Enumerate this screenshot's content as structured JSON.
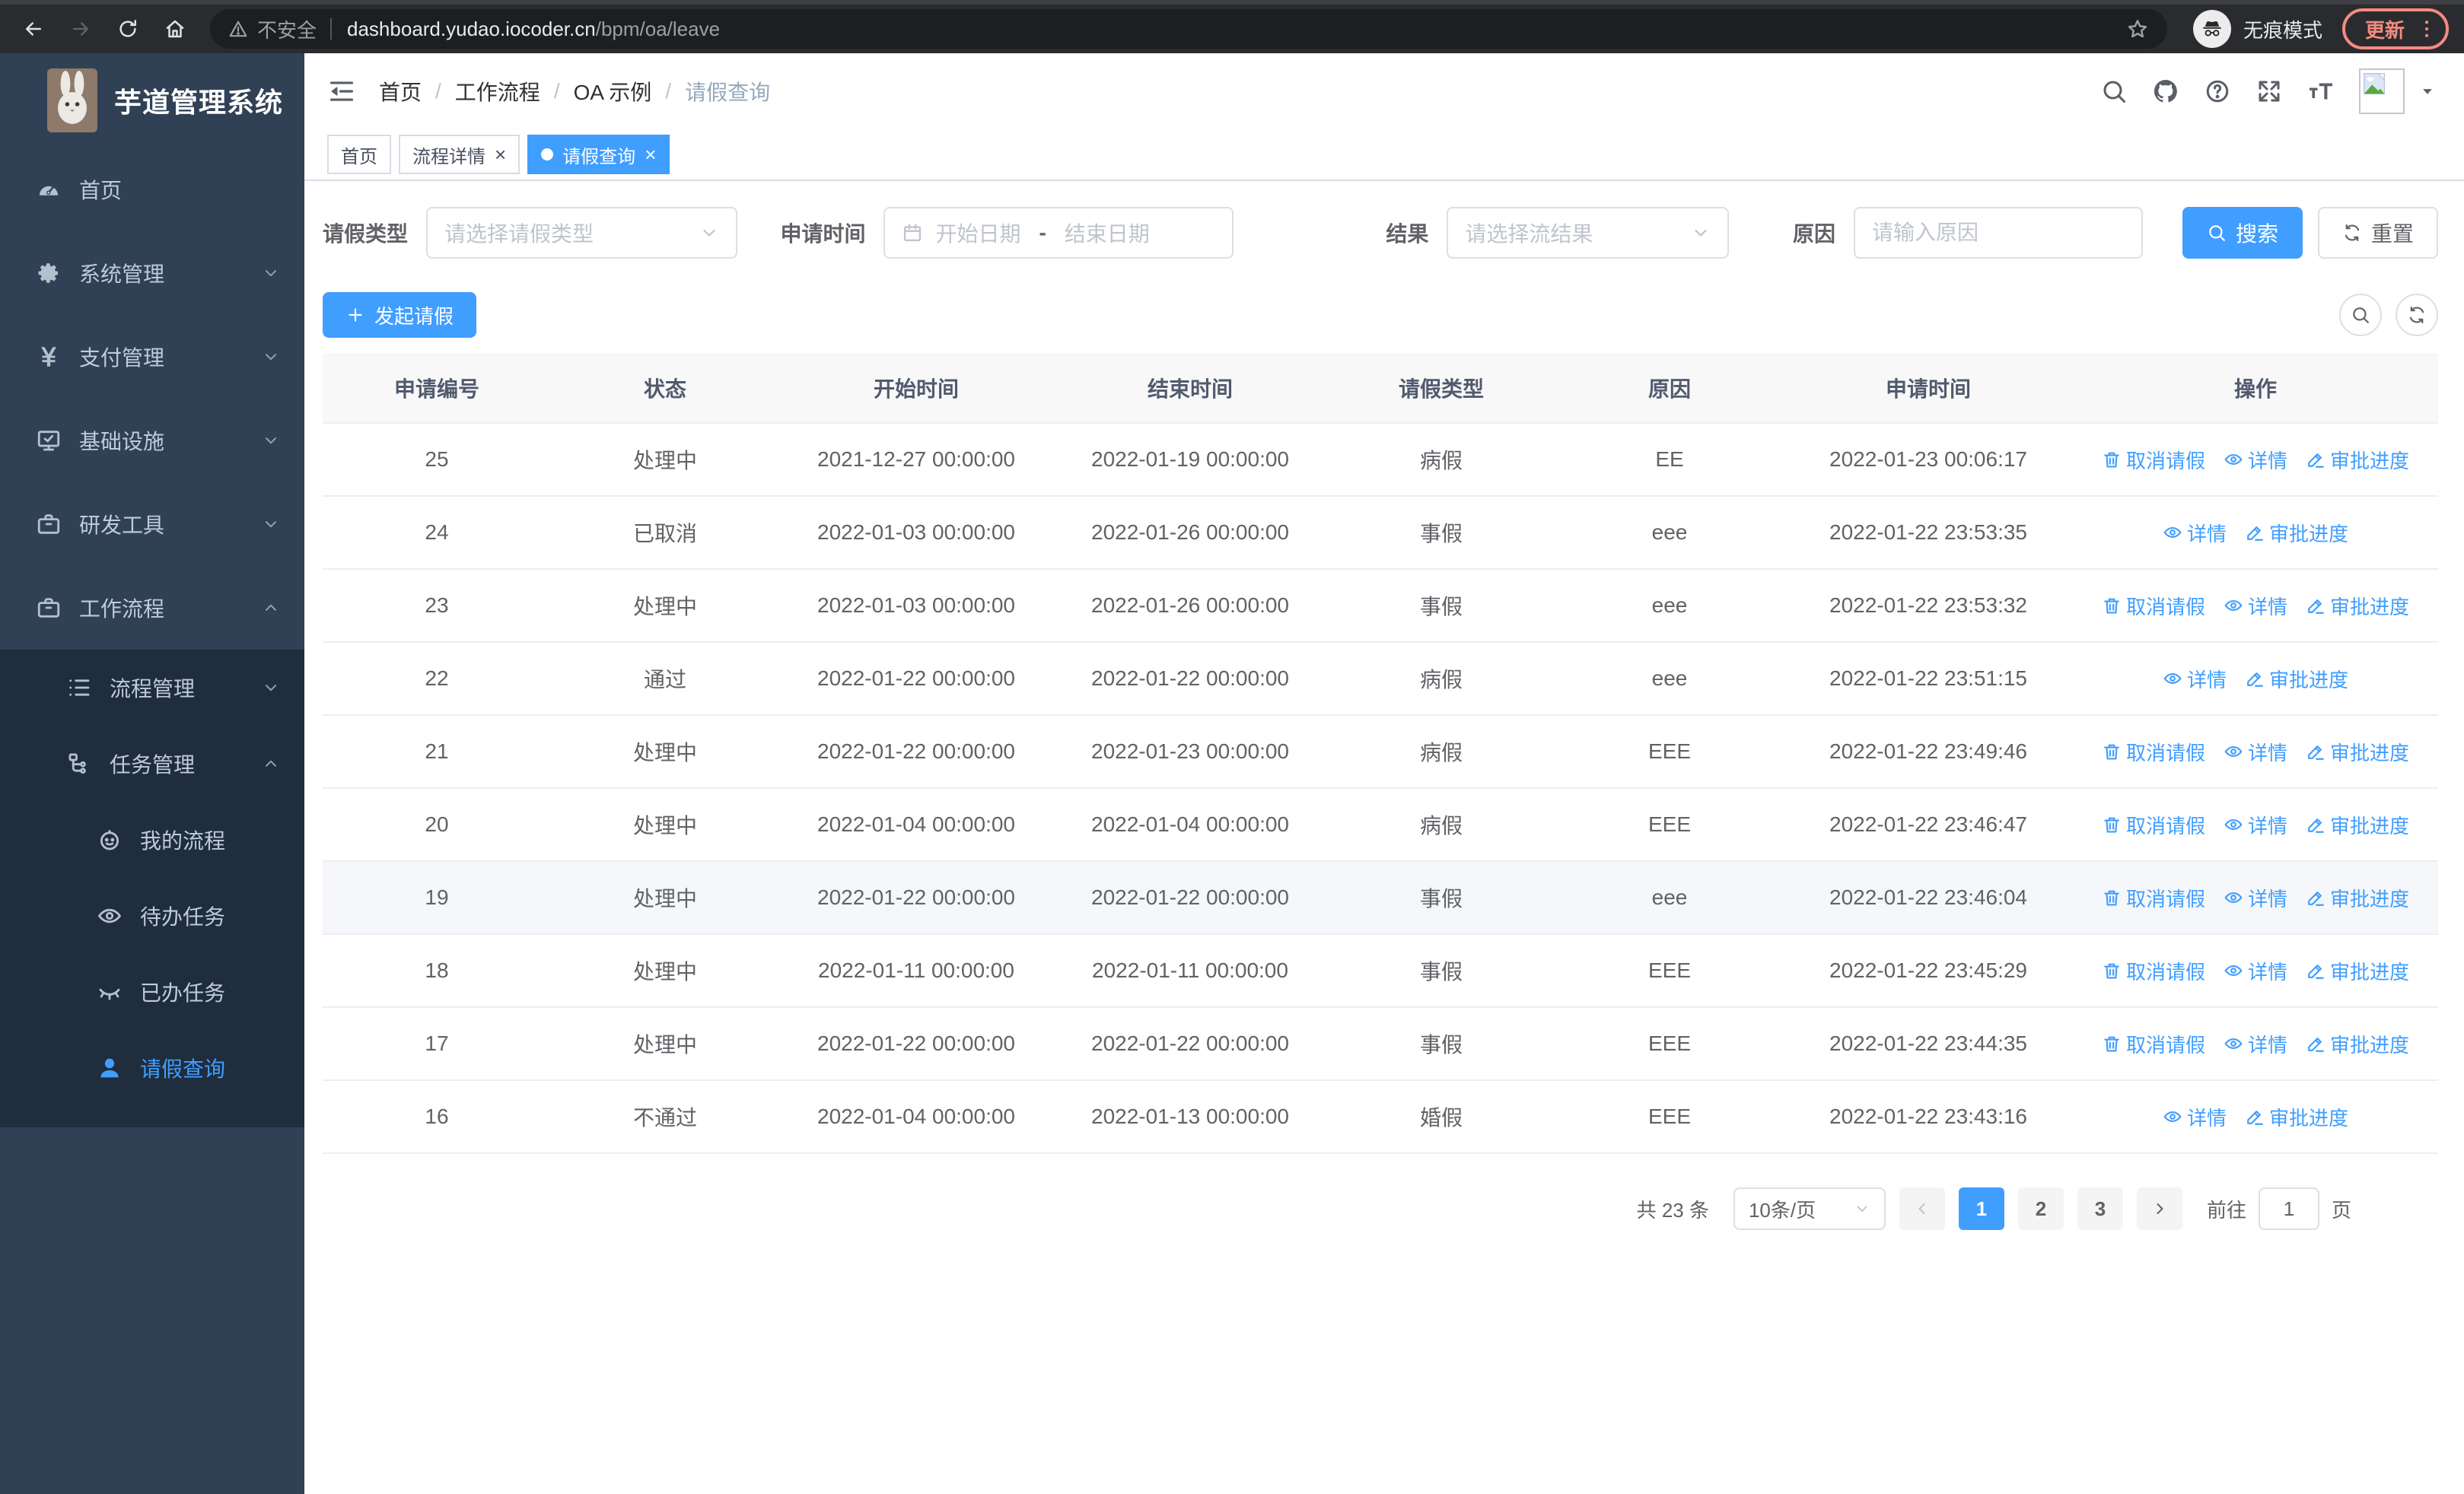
{
  "browser": {
    "security_label": "不安全",
    "url_host": "dashboard.yudao.iocoder.cn",
    "url_path": "/bpm/oa/leave",
    "incognito_label": "无痕模式",
    "update_label": "更新"
  },
  "app": {
    "title": "芋道管理系统"
  },
  "breadcrumb": [
    "首页",
    "工作流程",
    "OA 示例",
    "请假查询"
  ],
  "tabs": [
    {
      "label": "首页",
      "active": false,
      "closable": false
    },
    {
      "label": "流程详情",
      "active": false,
      "closable": true
    },
    {
      "label": "请假查询",
      "active": true,
      "closable": true
    }
  ],
  "sidebar": {
    "items": [
      {
        "label": "首页",
        "icon": "dashboard-icon"
      },
      {
        "label": "系统管理",
        "icon": "gear-icon",
        "arrow": "down"
      },
      {
        "label": "支付管理",
        "icon": "yen-icon",
        "arrow": "down"
      },
      {
        "label": "基础设施",
        "icon": "monitor-icon",
        "arrow": "down"
      },
      {
        "label": "研发工具",
        "icon": "briefcase-icon",
        "arrow": "down"
      },
      {
        "label": "工作流程",
        "icon": "workflow-icon",
        "arrow": "up",
        "children": [
          {
            "label": "流程管理",
            "icon": "list-icon",
            "arrow": "down"
          },
          {
            "label": "任务管理",
            "icon": "tree-icon",
            "arrow": "up",
            "children": [
              {
                "label": "我的流程",
                "icon": "face-icon"
              },
              {
                "label": "待办任务",
                "icon": "eye-icon"
              },
              {
                "label": "已办任务",
                "icon": "eye-closed-icon"
              },
              {
                "label": "请假查询",
                "icon": "user-icon",
                "active": true
              }
            ]
          }
        ]
      }
    ]
  },
  "filters": {
    "leave_type": {
      "label": "请假类型",
      "placeholder": "请选择请假类型"
    },
    "apply_time": {
      "label": "申请时间",
      "start_placeholder": "开始日期",
      "separator": "-",
      "end_placeholder": "结束日期"
    },
    "result": {
      "label": "结果",
      "placeholder": "请选择流结果"
    },
    "reason": {
      "label": "原因",
      "placeholder": "请输入原因"
    },
    "search_label": "搜索",
    "reset_label": "重置"
  },
  "toolbar": {
    "create_label": "发起请假"
  },
  "table": {
    "headers": [
      "申请编号",
      "状态",
      "开始时间",
      "结束时间",
      "请假类型",
      "原因",
      "申请时间",
      "操作"
    ],
    "highlighted_row_id": "19",
    "action_labels": {
      "cancel": "取消请假",
      "detail": "详情",
      "progress": "审批进度"
    },
    "rows": [
      {
        "id": "25",
        "status": "处理中",
        "start": "2021-12-27 00:00:00",
        "end": "2022-01-19 00:00:00",
        "type": "病假",
        "reason": "EE",
        "apply_time": "2022-01-23 00:06:17",
        "actions": [
          "cancel",
          "detail",
          "progress"
        ]
      },
      {
        "id": "24",
        "status": "已取消",
        "start": "2022-01-03 00:00:00",
        "end": "2022-01-26 00:00:00",
        "type": "事假",
        "reason": "eee",
        "apply_time": "2022-01-22 23:53:35",
        "actions": [
          "detail",
          "progress"
        ]
      },
      {
        "id": "23",
        "status": "处理中",
        "start": "2022-01-03 00:00:00",
        "end": "2022-01-26 00:00:00",
        "type": "事假",
        "reason": "eee",
        "apply_time": "2022-01-22 23:53:32",
        "actions": [
          "cancel",
          "detail",
          "progress"
        ]
      },
      {
        "id": "22",
        "status": "通过",
        "start": "2022-01-22 00:00:00",
        "end": "2022-01-22 00:00:00",
        "type": "病假",
        "reason": "eee",
        "apply_time": "2022-01-22 23:51:15",
        "actions": [
          "detail",
          "progress"
        ]
      },
      {
        "id": "21",
        "status": "处理中",
        "start": "2022-01-22 00:00:00",
        "end": "2022-01-23 00:00:00",
        "type": "病假",
        "reason": "EEE",
        "apply_time": "2022-01-22 23:49:46",
        "actions": [
          "cancel",
          "detail",
          "progress"
        ]
      },
      {
        "id": "20",
        "status": "处理中",
        "start": "2022-01-04 00:00:00",
        "end": "2022-01-04 00:00:00",
        "type": "病假",
        "reason": "EEE",
        "apply_time": "2022-01-22 23:46:47",
        "actions": [
          "cancel",
          "detail",
          "progress"
        ]
      },
      {
        "id": "19",
        "status": "处理中",
        "start": "2022-01-22 00:00:00",
        "end": "2022-01-22 00:00:00",
        "type": "事假",
        "reason": "eee",
        "apply_time": "2022-01-22 23:46:04",
        "actions": [
          "cancel",
          "detail",
          "progress"
        ]
      },
      {
        "id": "18",
        "status": "处理中",
        "start": "2022-01-11 00:00:00",
        "end": "2022-01-11 00:00:00",
        "type": "事假",
        "reason": "EEE",
        "apply_time": "2022-01-22 23:45:29",
        "actions": [
          "cancel",
          "detail",
          "progress"
        ]
      },
      {
        "id": "17",
        "status": "处理中",
        "start": "2022-01-22 00:00:00",
        "end": "2022-01-22 00:00:00",
        "type": "事假",
        "reason": "EEE",
        "apply_time": "2022-01-22 23:44:35",
        "actions": [
          "cancel",
          "detail",
          "progress"
        ]
      },
      {
        "id": "16",
        "status": "不通过",
        "start": "2022-01-04 00:00:00",
        "end": "2022-01-13 00:00:00",
        "type": "婚假",
        "reason": "EEE",
        "apply_time": "2022-01-22 23:43:16",
        "actions": [
          "detail",
          "progress"
        ]
      }
    ]
  },
  "pagination": {
    "total_label": "共 23 条",
    "page_size": "10条/页",
    "pages": [
      "1",
      "2",
      "3"
    ],
    "active_page": "1",
    "goto_label": "前往",
    "goto_value": "1",
    "goto_unit": "页"
  }
}
